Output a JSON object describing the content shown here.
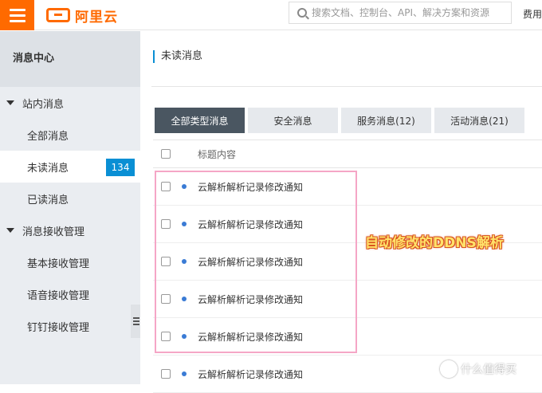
{
  "topbar": {
    "logo_text": "阿里云",
    "search_placeholder": "搜索文档、控制台、API、解决方案和资源",
    "right_text": "费用"
  },
  "sidebar": {
    "title": "消息中心",
    "sections": [
      {
        "label": "站内消息",
        "items": [
          {
            "label": "全部消息"
          },
          {
            "label": "未读消息",
            "badge": "134",
            "active": true
          },
          {
            "label": "已读消息"
          }
        ]
      },
      {
        "label": "消息接收管理",
        "items": [
          {
            "label": "基本接收管理"
          },
          {
            "label": "语音接收管理"
          },
          {
            "label": "钉钉接收管理"
          }
        ]
      }
    ]
  },
  "main": {
    "page_title": "未读消息",
    "tabs": [
      "全部类型消息",
      "安全消息",
      "服务消息(12)",
      "活动消息(21)"
    ],
    "table": {
      "header": "标题内容",
      "rows": [
        "云解析解析记录修改通知",
        "云解析解析记录修改通知",
        "云解析解析记录修改通知",
        "云解析解析记录修改通知",
        "云解析解析记录修改通知",
        "云解析解析记录修改通知"
      ]
    }
  },
  "annotation": "自动修改的DDNS解析",
  "watermark": "什么值得买",
  "colors": {
    "brand": "#ff6a00",
    "accent": "#0a8fd4",
    "active_tab": "#4a5661"
  }
}
